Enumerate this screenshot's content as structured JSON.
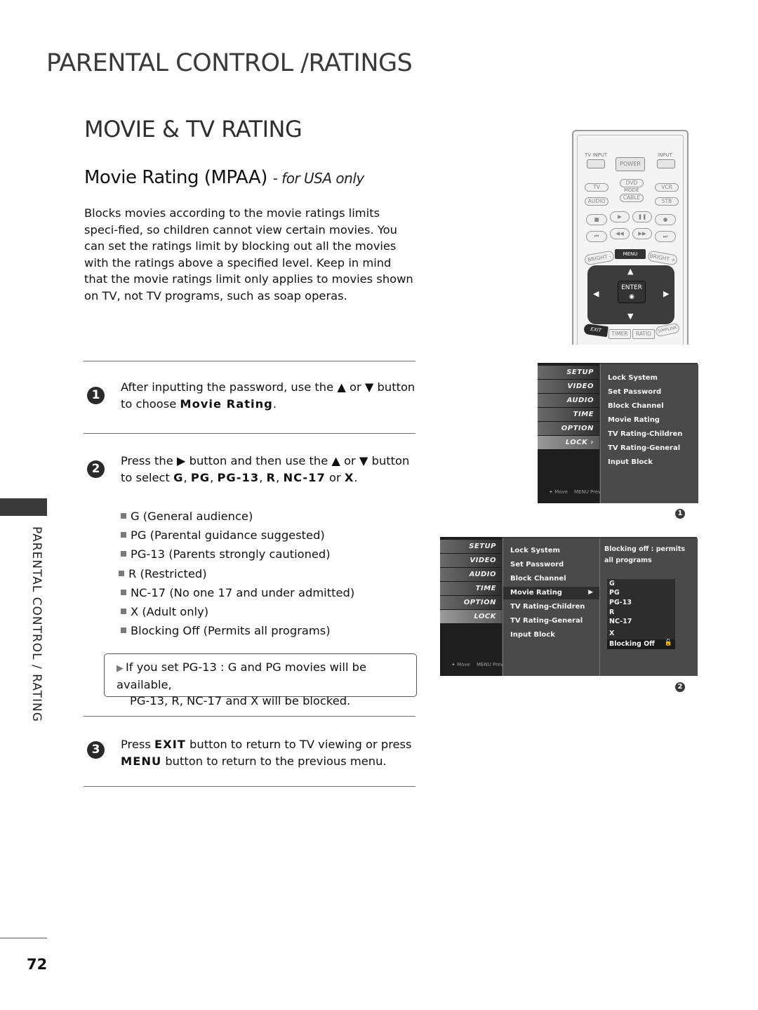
{
  "header": {
    "page_title": "PARENTAL CONTROL /RATINGS",
    "section_title": "MOVIE & TV RATING",
    "subtitle": "Movie Rating (MPAA)",
    "subtitle_note": "- for USA only"
  },
  "intro": "Blocks movies according to the movie ratings limits speci-fied, so children cannot view certain movies. You can set the ratings limit by blocking out all the movies with the ratings above a specified level. Keep in mind that the movie ratings limit only applies to movies shown on TV, not TV programs, such as soap operas.",
  "steps": [
    {
      "number": "1",
      "line1": "After inputting the password, use the ▲ or ▼ button",
      "line2_prefix": "to choose ",
      "line2_bold": "Movie Rating",
      "line2_suffix": "."
    },
    {
      "number": "2",
      "line1": "Press the ▶ button and then use the  ▲ or ▼ button",
      "line2_prefix": "to select ",
      "options_bold": [
        "G",
        "PG",
        "PG-13",
        "R",
        "NC-17",
        "X"
      ],
      "sep": ", ",
      "or": " or ",
      "end": "."
    },
    {
      "number": "3",
      "l1_prefix": "Press ",
      "l1_bold": "EXIT",
      "l1_suffix": " button to return to TV viewing or press",
      "l2_bold": "MENU",
      "l2_suffix": " button to return to the previous menu."
    }
  ],
  "ratings": [
    "G (General audience)",
    "PG (Parental guidance suggested)",
    "PG-13  (Parents strongly cautioned)",
    "R (Restricted)",
    "NC-17  (No one 17 and under admitted)",
    "X (Adult only)",
    "Blocking Off (Permits all programs)"
  ],
  "note": {
    "arrow": "▶",
    "line1": "If you set PG-13 : G and PG movies will be available,",
    "line2": "PG-13, R, NC-17 and X will be blocked."
  },
  "side_label": "PARENTAL CONTROL / RATING",
  "page_number": "72",
  "remote": {
    "tv_input": "TV INPUT",
    "input": "INPUT",
    "power": "POWER",
    "mode_buttons": [
      "TV",
      "DVD",
      "VCR",
      "AUDIO",
      "CABLE",
      "STB"
    ],
    "mode_label": "MODE",
    "transport_row1": [
      "■",
      "▶",
      "❚❚",
      "●"
    ],
    "transport_row2": [
      "⏮",
      "◀◀",
      "▶▶",
      "⏭"
    ],
    "bright_minus": "BRIGHT -",
    "menu": "MENU",
    "bright_plus": "BRIGHT +",
    "enter": "ENTER",
    "enter_symbol": "◉",
    "up": "▲",
    "down": "▼",
    "left": "◀",
    "right": "▶",
    "exit": "EXIT",
    "bottom_buttons": [
      "TIMER",
      "RATIO",
      "SIMPLINK"
    ]
  },
  "osd1": {
    "categories": [
      "SETUP",
      "VIDEO",
      "AUDIO",
      "TIME",
      "OPTION",
      "LOCK ›"
    ],
    "items": [
      "Lock System",
      "Set Password",
      "Block Channel",
      "Movie Rating",
      "TV Rating-Children",
      "TV Rating-General",
      "Input Block"
    ],
    "footer_move": "✦ Move",
    "footer_prev": "MENU Prev",
    "figure": "1"
  },
  "osd2": {
    "categories": [
      "SETUP",
      "VIDEO",
      "AUDIO",
      "TIME",
      "OPTION",
      "LOCK"
    ],
    "items": [
      "Lock System",
      "Set Password",
      "Block Channel",
      "Movie Rating",
      "TV Rating-Children",
      "TV Rating-General",
      "Input Block"
    ],
    "selected_arrow": "▶",
    "description": "Blocking off : permits all programs",
    "rating_options": [
      "G",
      "PG",
      "PG-13",
      "R",
      "NC-17",
      "X"
    ],
    "selected_rating": "Blocking Off",
    "lock_icon": "🔓",
    "footer_move": "✦ Move",
    "footer_prev": "MENU Prev",
    "figure": "2"
  }
}
